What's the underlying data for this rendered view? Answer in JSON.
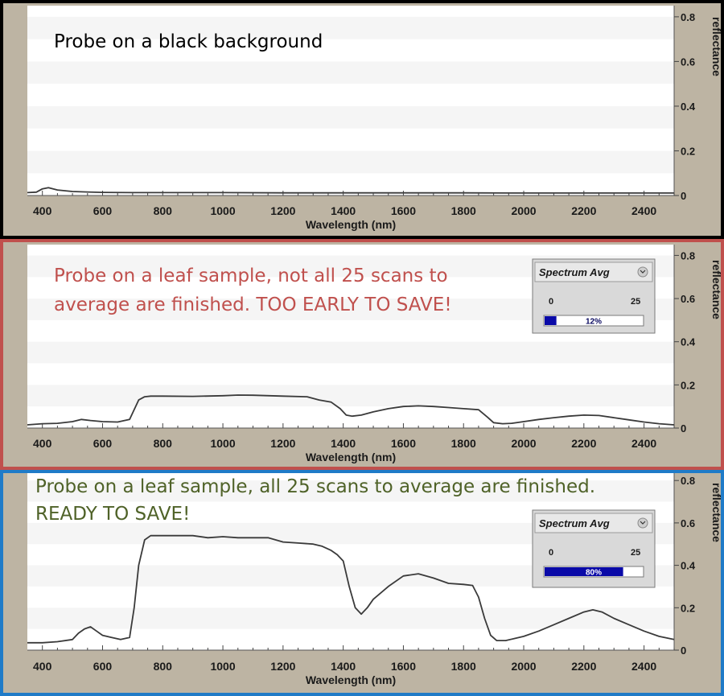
{
  "colors": {
    "frame_bg": "#bdb4a3",
    "plot_bg": "#ffffff",
    "plot_band": "#f5f5f5",
    "line": "#3a3a3a",
    "border_panel1": "#000000",
    "border_panel2": "#c0504d",
    "border_panel3": "#1f7bc8",
    "caption_panel1": "#000000",
    "caption_panel2": "#c0504d",
    "caption_panel3": "#4f6228",
    "progress_fill": "#0a0aa8",
    "widget_bg": "#d9d9d9"
  },
  "panels": [
    {
      "caption_lines": [
        "Probe on a black background"
      ],
      "widget": null
    },
    {
      "caption_lines": [
        "Probe on a leaf sample, not all 25 scans to",
        "average are finished. TOO EARLY TO SAVE!"
      ],
      "widget": {
        "title": "Spectrum Avg",
        "min": "0",
        "max": "25",
        "percent_label": "12%",
        "progress": 0.12
      }
    },
    {
      "caption_lines": [
        "Probe on a leaf sample, all 25 scans to average are finished.",
        "READY TO SAVE!"
      ],
      "widget": {
        "title": "Spectrum Avg",
        "min": "0",
        "max": "25",
        "percent_label": "80%",
        "progress": 0.8
      }
    }
  ],
  "chart_data": [
    {
      "type": "line",
      "xlabel": "Wavelength (nm)",
      "ylabel": "reflectance",
      "xlim": [
        350,
        2500
      ],
      "ylim": [
        0,
        0.85
      ],
      "xticks": [
        400,
        600,
        800,
        1000,
        1200,
        1400,
        1600,
        1800,
        2000,
        2200,
        2400
      ],
      "yticks": [
        "0",
        "0.2",
        "0.4",
        "0.6",
        "0.8"
      ],
      "grid": "horizontal bands",
      "series": [
        {
          "x": [
            350,
            380,
            400,
            420,
            450,
            500,
            550,
            600,
            700,
            800,
            1000,
            1200,
            1400,
            1600,
            1800,
            2000,
            2200,
            2400,
            2500
          ],
          "y": [
            0.013,
            0.015,
            0.03,
            0.035,
            0.025,
            0.018,
            0.016,
            0.014,
            0.013,
            0.013,
            0.013,
            0.012,
            0.012,
            0.012,
            0.012,
            0.011,
            0.011,
            0.011,
            0.011
          ]
        }
      ]
    },
    {
      "type": "line",
      "xlabel": "Wavelength (nm)",
      "ylabel": "reflectance",
      "xlim": [
        350,
        2500
      ],
      "ylim": [
        0,
        0.85
      ],
      "xticks": [
        400,
        600,
        800,
        1000,
        1200,
        1400,
        1600,
        1800,
        2000,
        2200,
        2400
      ],
      "yticks": [
        "0",
        "0.2",
        "0.4",
        "0.6",
        "0.8"
      ],
      "grid": "horizontal bands",
      "series": [
        {
          "x": [
            350,
            400,
            450,
            500,
            530,
            560,
            600,
            650,
            690,
            720,
            740,
            760,
            800,
            900,
            1000,
            1050,
            1100,
            1200,
            1280,
            1320,
            1360,
            1390,
            1410,
            1430,
            1460,
            1500,
            1550,
            1600,
            1650,
            1700,
            1750,
            1800,
            1850,
            1880,
            1900,
            1930,
            1960,
            2000,
            2050,
            2100,
            2150,
            2200,
            2250,
            2300,
            2350,
            2400,
            2450,
            2500
          ],
          "y": [
            0.015,
            0.02,
            0.022,
            0.03,
            0.04,
            0.035,
            0.03,
            0.028,
            0.04,
            0.13,
            0.145,
            0.148,
            0.148,
            0.147,
            0.15,
            0.153,
            0.152,
            0.148,
            0.145,
            0.13,
            0.12,
            0.09,
            0.06,
            0.055,
            0.06,
            0.075,
            0.09,
            0.1,
            0.103,
            0.1,
            0.095,
            0.09,
            0.085,
            0.05,
            0.025,
            0.02,
            0.022,
            0.03,
            0.04,
            0.048,
            0.055,
            0.06,
            0.058,
            0.048,
            0.038,
            0.028,
            0.02,
            0.015
          ]
        }
      ]
    },
    {
      "type": "line",
      "xlabel": "Wavelength (nm)",
      "ylabel": "reflectance",
      "xlim": [
        350,
        2500
      ],
      "ylim": [
        0,
        0.85
      ],
      "xticks": [
        400,
        600,
        800,
        1000,
        1200,
        1400,
        1600,
        1800,
        2000,
        2200,
        2400
      ],
      "yticks": [
        "0",
        "0.2",
        "0.4",
        "0.6",
        "0.8"
      ],
      "grid": "horizontal bands",
      "series": [
        {
          "x": [
            350,
            400,
            450,
            500,
            520,
            540,
            560,
            580,
            600,
            630,
            660,
            690,
            705,
            720,
            740,
            760,
            800,
            900,
            950,
            1000,
            1050,
            1100,
            1150,
            1200,
            1250,
            1300,
            1330,
            1360,
            1380,
            1400,
            1420,
            1440,
            1460,
            1480,
            1500,
            1550,
            1600,
            1650,
            1700,
            1750,
            1800,
            1830,
            1850,
            1870,
            1890,
            1910,
            1940,
            1970,
            2000,
            2050,
            2100,
            2150,
            2200,
            2230,
            2260,
            2300,
            2350,
            2400,
            2450,
            2500
          ],
          "y": [
            0.035,
            0.035,
            0.04,
            0.05,
            0.08,
            0.1,
            0.11,
            0.09,
            0.07,
            0.06,
            0.05,
            0.06,
            0.2,
            0.4,
            0.52,
            0.54,
            0.54,
            0.54,
            0.53,
            0.535,
            0.53,
            0.53,
            0.53,
            0.51,
            0.505,
            0.5,
            0.49,
            0.47,
            0.45,
            0.42,
            0.3,
            0.2,
            0.17,
            0.2,
            0.24,
            0.3,
            0.35,
            0.36,
            0.34,
            0.315,
            0.31,
            0.305,
            0.25,
            0.15,
            0.07,
            0.045,
            0.045,
            0.055,
            0.065,
            0.09,
            0.12,
            0.15,
            0.18,
            0.19,
            0.18,
            0.15,
            0.12,
            0.09,
            0.065,
            0.05
          ]
        }
      ]
    }
  ]
}
